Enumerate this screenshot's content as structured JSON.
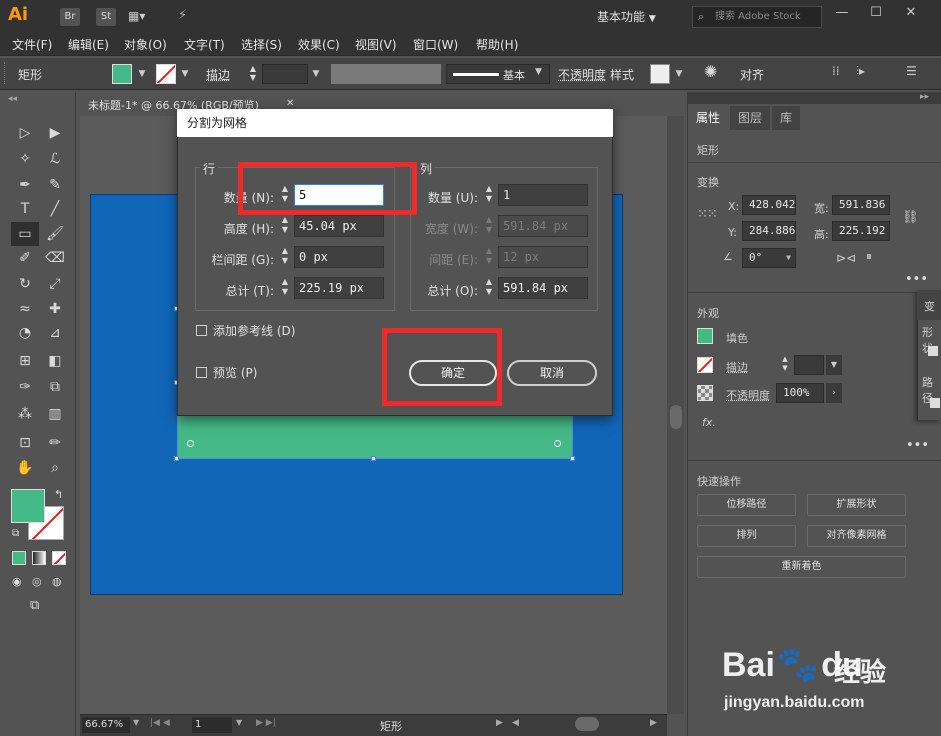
{
  "titlebar": {
    "app_logo": "Ai",
    "br": "Br",
    "st": "St",
    "workspace": "基本功能",
    "search_placeholder": "搜索 Adobe Stock",
    "minimize": "—",
    "maximize": "☐",
    "close": "✕"
  },
  "menubar": {
    "items": [
      "文件(F)",
      "编辑(E)",
      "对象(O)",
      "文字(T)",
      "选择(S)",
      "效果(C)",
      "视图(V)",
      "窗口(W)",
      "帮助(H)"
    ]
  },
  "controlbar": {
    "object_type": "矩形",
    "stroke_label": "描边",
    "stroke_style": "基本",
    "opacity_label": "不透明度",
    "style_label": "样式",
    "align_label": "对齐",
    "fill_color": "#44b886"
  },
  "document": {
    "tab_title": "未标题-1* @ 66.67% (RGB/预览)",
    "zoom": "66.67%",
    "page": "1",
    "status_tool": "矩形",
    "artboard_color": "#1166b8",
    "rect_color": "#44b886"
  },
  "dialog": {
    "title": "分割为网格",
    "rows": {
      "group_title": "行",
      "count_label": "数量 (N):",
      "count_value": "5",
      "height_label": "高度 (H):",
      "height_value": "45.04 px",
      "gutter_label": "栏间距 (G):",
      "gutter_value": "0 px",
      "total_label": "总计 (T):",
      "total_value": "225.19 px"
    },
    "columns": {
      "group_title": "列",
      "count_label": "数量 (U):",
      "count_value": "1",
      "width_label": "宽度 (W):",
      "width_value": "591.84 px",
      "gutter_label": "间距 (E):",
      "gutter_value": "12 px",
      "total_label": "总计 (O):",
      "total_value": "591.84 px"
    },
    "add_guides": "添加参考线 (D)",
    "preview": "预览 (P)",
    "ok": "确定",
    "cancel": "取消"
  },
  "properties": {
    "tabs": [
      "属性",
      "图层",
      "库"
    ],
    "object_type": "矩形",
    "transform_title": "变换",
    "x_label": "X:",
    "x_value": "428.042",
    "y_label": "Y:",
    "y_value": "284.886",
    "w_label": "宽:",
    "w_value": "591.836",
    "h_label": "高:",
    "h_value": "225.192",
    "angle_value": "0°",
    "appearance_title": "外观",
    "fill_label": "填色",
    "stroke_label": "描边",
    "opacity_label": "不透明度",
    "opacity_value": "100%",
    "fx_label": "fx.",
    "quick_actions_title": "快速操作",
    "btn_offset_path": "位移路径",
    "btn_expand_shape": "扩展形状",
    "btn_arrange": "排列",
    "btn_align_pixel": "对齐像素网格",
    "btn_recolor": "重新着色"
  },
  "side_panel": {
    "t1": "变",
    "t2": "形状",
    "t3": "路径"
  },
  "watermark": {
    "brand": "Bai",
    "brand2": "du",
    "cn": "经验",
    "url": "jingyan.baidu.com"
  }
}
